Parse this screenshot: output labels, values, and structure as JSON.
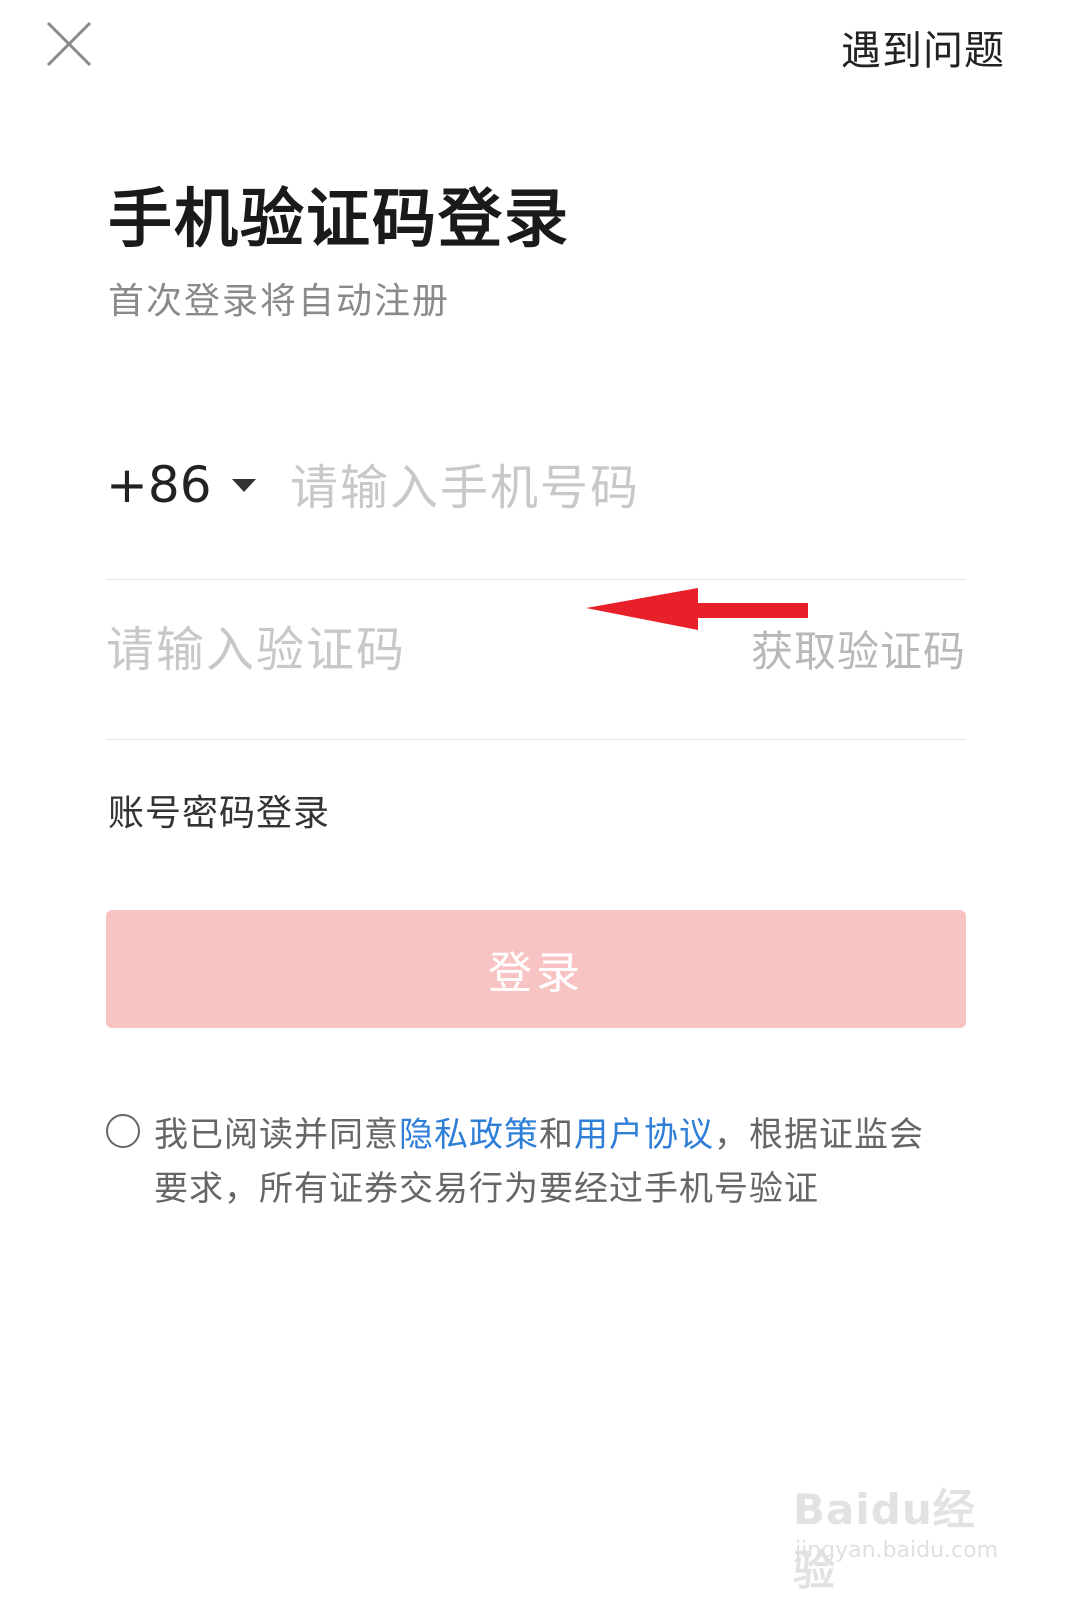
{
  "header": {
    "close_icon": "close-icon",
    "help_label": "遇到问题"
  },
  "title": "手机验证码登录",
  "subtitle": "首次登录将自动注册",
  "phone": {
    "country_code": "+86",
    "placeholder": "请输入手机号码",
    "value": ""
  },
  "code": {
    "placeholder": "请输入验证码",
    "value": "",
    "get_code_label": "获取验证码"
  },
  "annotation": {
    "icon": "red-arrow-left",
    "color": "#e8202a"
  },
  "password_login_label": "账号密码登录",
  "login_button": {
    "label": "登录",
    "color": "#f7c3c3"
  },
  "agreement": {
    "checked": false,
    "text_prefix": "我已阅读并同意",
    "privacy_link": "隐私政策",
    "and": "和",
    "user_agreement_link": "用户协议",
    "text_suffix": "，根据证监会要求，所有证券交易行为要经过手机号验证",
    "link_color": "#2f7ed8"
  },
  "watermark": {
    "logo": "Baidu经验",
    "url": "jingyan.baidu.com"
  }
}
